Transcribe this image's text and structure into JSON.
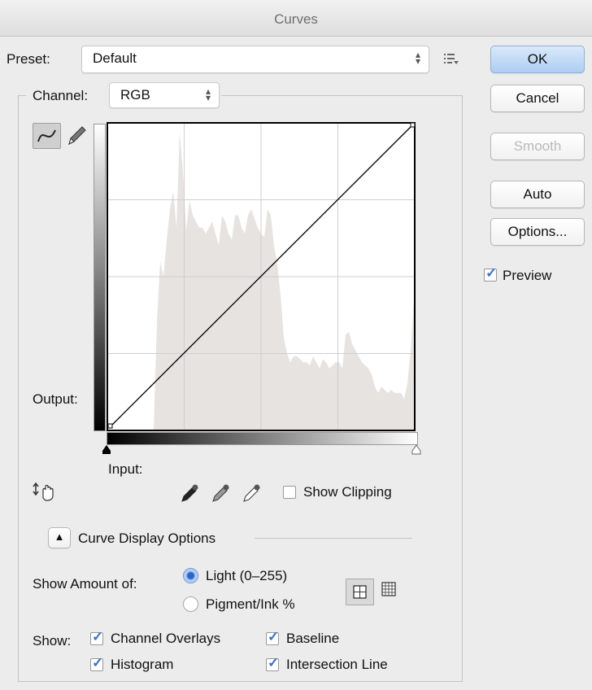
{
  "window": {
    "title": "Curves"
  },
  "preset": {
    "label": "Preset:",
    "value": "Default"
  },
  "channel": {
    "label": "Channel:",
    "value": "RGB"
  },
  "buttons": {
    "ok": "OK",
    "cancel": "Cancel",
    "smooth": "Smooth",
    "auto": "Auto",
    "options": "Options..."
  },
  "preview": {
    "label": "Preview",
    "checked": true
  },
  "graph": {
    "output_label": "Output:",
    "input_label": "Input:",
    "histogram": [
      0,
      0,
      0,
      0,
      0,
      0,
      0,
      0,
      0,
      0,
      0,
      0,
      0,
      0,
      0,
      0.35,
      0.55,
      0.5,
      0.62,
      0.72,
      0.78,
      0.66,
      0.97,
      0.84,
      0.65,
      0.75,
      0.7,
      0.68,
      0.66,
      0.66,
      0.64,
      0.66,
      0.68,
      0.64,
      0.6,
      0.7,
      0.68,
      0.64,
      0.62,
      0.7,
      0.7,
      0.66,
      0.64,
      0.7,
      0.72,
      0.69,
      0.66,
      0.64,
      0.63,
      0.72,
      0.7,
      0.6,
      0.54,
      0.44,
      0.3,
      0.25,
      0.22,
      0.24,
      0.24,
      0.23,
      0.22,
      0.22,
      0.21,
      0.24,
      0.22,
      0.2,
      0.23,
      0.22,
      0.2,
      0.21,
      0.22,
      0.22,
      0.2,
      0.31,
      0.32,
      0.28,
      0.26,
      0.24,
      0.22,
      0.21,
      0.2,
      0.18,
      0.14,
      0.12,
      0.14,
      0.13,
      0.12,
      0.13,
      0.12,
      0.12,
      0.12,
      0.1,
      0.15,
      0.26,
      0.42
    ]
  },
  "show_clipping": {
    "label": "Show Clipping",
    "checked": false
  },
  "display_options": {
    "heading": "Curve Display Options",
    "show_amount_label": "Show Amount of:",
    "light_label": "Light  (0–255)",
    "pigment_label": "Pigment/Ink %",
    "selected": "light",
    "show_label": "Show:",
    "channel_overlays": "Channel Overlays",
    "baseline": "Baseline",
    "histogram": "Histogram",
    "intersection_line": "Intersection Line"
  }
}
